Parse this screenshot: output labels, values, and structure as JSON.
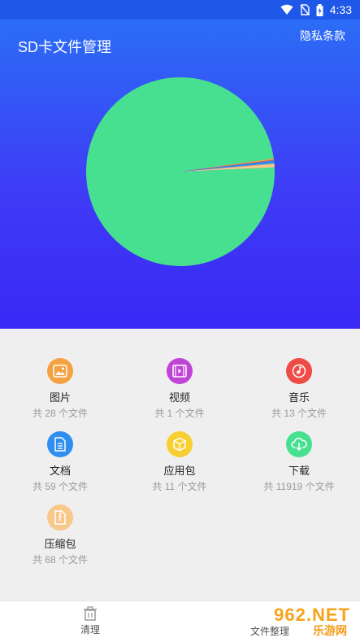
{
  "status_bar": {
    "time": "4:33"
  },
  "header": {
    "title": "SD卡文件管理",
    "privacy_link": "隐私条款"
  },
  "chart_data": {
    "type": "pie",
    "categories": [
      "下载",
      "图片",
      "视频",
      "音乐",
      "文档",
      "应用包",
      "压缩包"
    ],
    "values": [
      11919,
      28,
      1,
      13,
      59,
      11,
      68
    ],
    "colors": [
      "#47e090",
      "#f5a142",
      "#c044d6",
      "#ef4c48",
      "#2f8ef0",
      "#f8cf33",
      "#f7c88a"
    ]
  },
  "categories": [
    {
      "name": "图片",
      "count": "共 28 个文件",
      "icon": "image-icon",
      "color": "#f5a142"
    },
    {
      "name": "视频",
      "count": "共 1 个文件",
      "icon": "video-icon",
      "color": "#c044d6"
    },
    {
      "name": "音乐",
      "count": "共 13 个文件",
      "icon": "music-icon",
      "color": "#ef4c48"
    },
    {
      "name": "文档",
      "count": "共 59 个文件",
      "icon": "document-icon",
      "color": "#2f8ef0"
    },
    {
      "name": "应用包",
      "count": "共 11 个文件",
      "icon": "package-icon",
      "color": "#f8cf33"
    },
    {
      "name": "下载",
      "count": "共 11919 个文件",
      "icon": "download-icon",
      "color": "#47e090"
    },
    {
      "name": "压缩包",
      "count": "共 68 个文件",
      "icon": "zip-icon",
      "color": "#f7c88a"
    }
  ],
  "bottom_nav": {
    "clean_label": "清理",
    "files_label": "文件整理"
  },
  "watermark": {
    "big": "962.NET",
    "small": "乐游网"
  }
}
